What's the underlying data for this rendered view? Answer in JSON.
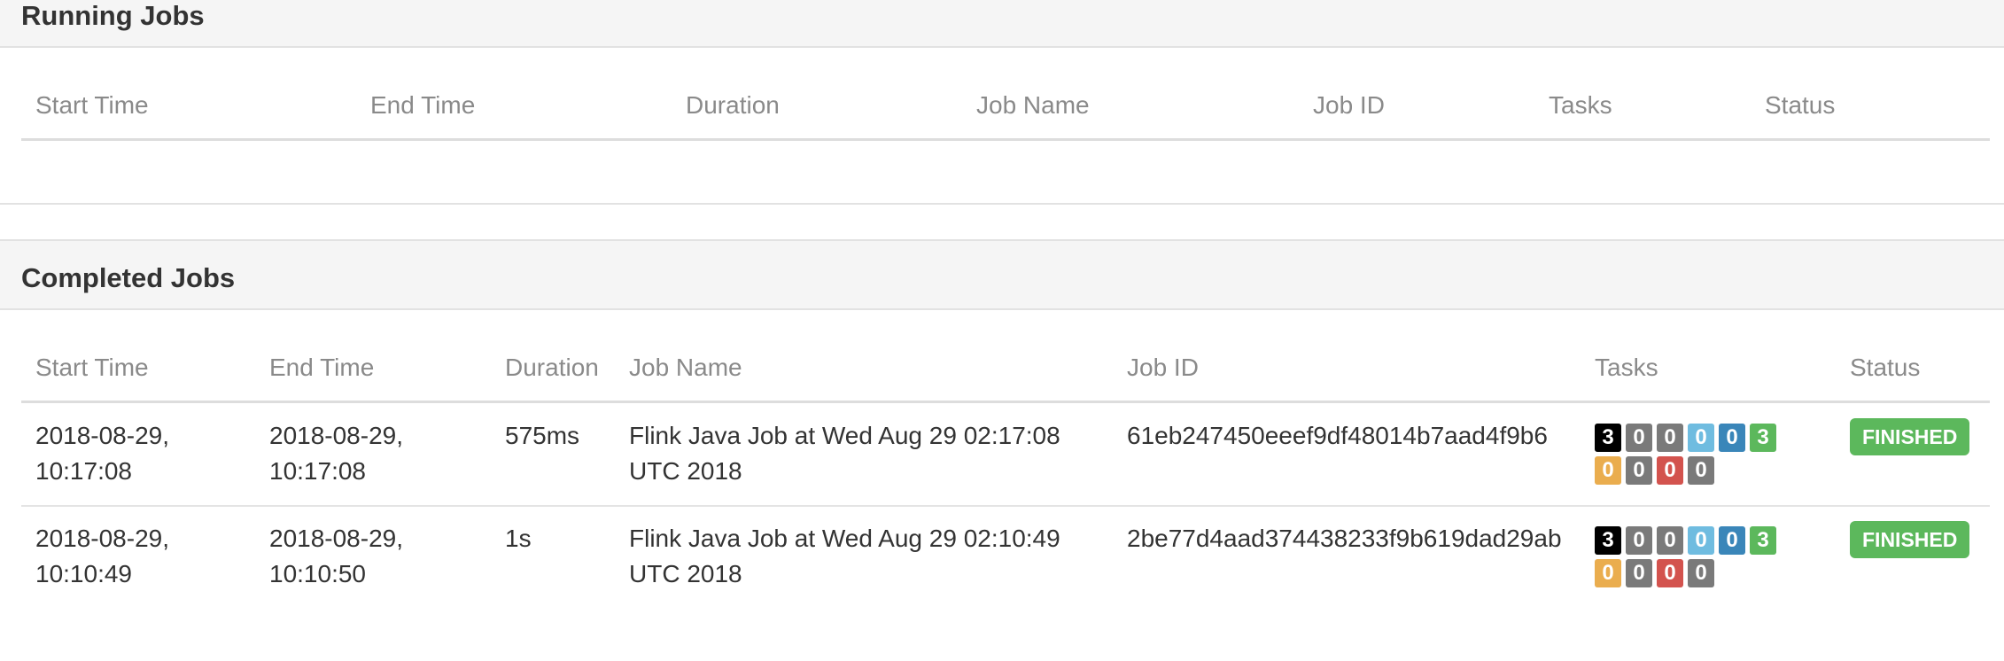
{
  "running": {
    "title": "Running Jobs",
    "headers": {
      "start_time": "Start Time",
      "end_time": "End Time",
      "duration": "Duration",
      "job_name": "Job Name",
      "job_id": "Job ID",
      "tasks": "Tasks",
      "status": "Status"
    },
    "rows": []
  },
  "completed": {
    "title": "Completed Jobs",
    "headers": {
      "start_time": "Start Time",
      "end_time": "End Time",
      "duration": "Duration",
      "job_name": "Job Name",
      "job_id": "Job ID",
      "tasks": "Tasks",
      "status": "Status"
    },
    "rows": [
      {
        "start_date": "2018-08-29,",
        "start_clock": "10:17:08",
        "end_date": "2018-08-29,",
        "end_clock": "10:17:08",
        "duration": "575ms",
        "job_name_line1": "Flink Java Job at Wed Aug 29 02:17:08",
        "job_name_line2": "UTC 2018",
        "job_id": "61eb247450eeef9df48014b7aad4f9b6",
        "tasks": [
          "3",
          "0",
          "0",
          "0",
          "0",
          "3",
          "0",
          "0",
          "0",
          "0"
        ],
        "status": "FINISHED"
      },
      {
        "start_date": "2018-08-29,",
        "start_clock": "10:10:49",
        "end_date": "2018-08-29,",
        "end_clock": "10:10:50",
        "duration": "1s",
        "job_name_line1": "Flink Java Job at Wed Aug 29 02:10:49",
        "job_name_line2": "UTC 2018",
        "job_id": "2be77d4aad374438233f9b619dad29ab",
        "tasks": [
          "3",
          "0",
          "0",
          "0",
          "0",
          "3",
          "0",
          "0",
          "0",
          "0"
        ],
        "status": "FINISHED"
      }
    ]
  },
  "task_badge_colors": [
    "#000000",
    "#7a7a7a",
    "#7a7a7a",
    "#6fbce0",
    "#3a86b9",
    "#5cb85c",
    "#eaad4e",
    "#7a7a7a",
    "#d3534e",
    "#7a7a7a"
  ],
  "status_color": "#5cb85c"
}
